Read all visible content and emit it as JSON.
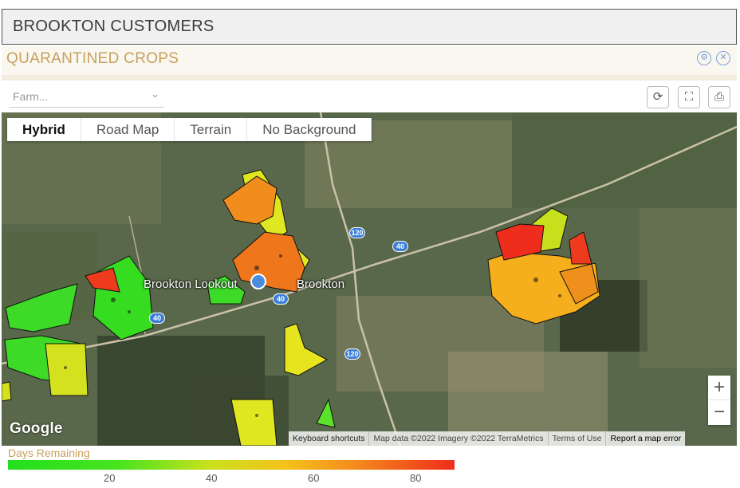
{
  "header": {
    "title": "BROOKTON CUSTOMERS",
    "panel_title": "QUARANTINED CROPS"
  },
  "filter": {
    "farm_placeholder": "Farm..."
  },
  "toolbar": {
    "refresh_icon": "refresh-icon",
    "fullscreen_icon": "fullscreen-icon",
    "print_icon": "print-icon"
  },
  "map": {
    "types": [
      "Hybrid",
      "Road Map",
      "Terrain",
      "No Background"
    ],
    "active_type": "Hybrid",
    "places": [
      "Brookton Lookout",
      "Brookton"
    ],
    "route_shields": [
      "120",
      "40",
      "40",
      "40",
      "120"
    ],
    "zoom_in": "+",
    "zoom_out": "−",
    "logo": "Google",
    "attribution": [
      "Keyboard shortcuts",
      "Map data ©2022 Imagery ©2022 TerraMetrics",
      "Terms of Use",
      "Report a map error"
    ]
  },
  "legend": {
    "title": "Days Remaining",
    "ticks": [
      "20",
      "40",
      "60",
      "80"
    ],
    "colors": {
      "low": "#22e01e",
      "mid": "#f5c21b",
      "high": "#f02c1c"
    }
  }
}
